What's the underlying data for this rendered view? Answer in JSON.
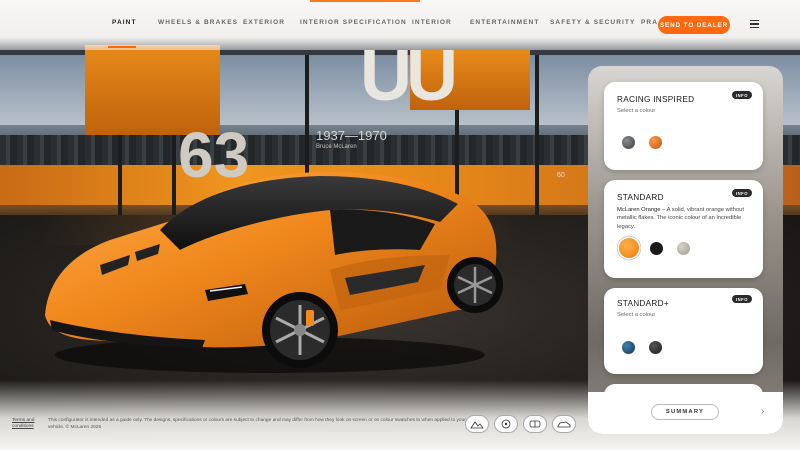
{
  "nav": {
    "tabs": [
      {
        "label": "PAINT"
      },
      {
        "label": "WHEELS & BRAKES"
      },
      {
        "label": "EXTERIOR"
      },
      {
        "label": "INTERIOR SPECIFICATION"
      },
      {
        "label": "INTERIOR"
      },
      {
        "label": "ENTERTAINMENT"
      },
      {
        "label": "SAFETY & SECURITY"
      },
      {
        "label": "PRA"
      }
    ],
    "active_tab": "PAINT",
    "send_button": "SEND TO DEALER",
    "menu_icon": "hamburger-menu-icon",
    "accent": "#ff6a10"
  },
  "scene": {
    "wall_text_large": "63",
    "wall_text_years": "1937—1970",
    "wall_text_name": "Bruce McLaren",
    "wall_text_top": "UU",
    "wall_text_small": "60"
  },
  "paint_panel": {
    "cards": [
      {
        "title": "RACING INSPIRED",
        "info": "INFO",
        "subtitle": "Select a colour",
        "swatches": [
          {
            "color": "#5c5f63",
            "selected": false
          },
          {
            "color": "#e86a10",
            "selected": false
          }
        ]
      },
      {
        "title": "STANDARD",
        "info": "INFO",
        "desc_name": "McLaren Orange",
        "desc_text": " – A solid, vibrant orange without metallic flakes. The iconic colour of an incredible legacy.",
        "swatches": [
          {
            "color": "#ff8a10",
            "selected": true
          },
          {
            "color": "#1c1c1c",
            "selected": false
          },
          {
            "color": "#b8b5ac",
            "selected": false
          }
        ]
      },
      {
        "title": "STANDARD+",
        "info": "INFO",
        "subtitle": "Select a colour",
        "swatches": [
          {
            "color": "#1f4e73",
            "selected": false
          },
          {
            "color": "#2a2a2a",
            "selected": false
          }
        ]
      }
    ],
    "summary_button": "SUMMARY",
    "next_icon": "chevron-right-icon"
  },
  "footer": {
    "terms_link": "Terms and conditions",
    "disclaimer": "This configurator is intended as a guide only. The designs, specifications or colours are subject to change and may differ from how they look on screen or on colour swatches to when applied to your vehicle. © McLaren 2025",
    "view_buttons": [
      "mountain-view-icon",
      "steering-wheel-icon",
      "interior-seat-icon",
      "car-side-icon"
    ]
  }
}
